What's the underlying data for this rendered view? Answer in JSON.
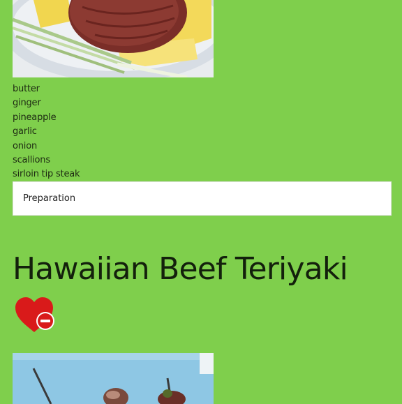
{
  "recipe_previous": {
    "ingredients": [
      "butter",
      "ginger",
      "pineapple",
      "garlic",
      "onion",
      "scallions",
      "sirloin tip steak"
    ],
    "preparation_label": "Preparation"
  },
  "recipe": {
    "title": "Hawaiian Beef Teriyaki",
    "favorite_icon": "heart-remove-icon"
  },
  "colors": {
    "page_background": "#7fcf4c",
    "favorite_icon": "#d91a1a"
  }
}
